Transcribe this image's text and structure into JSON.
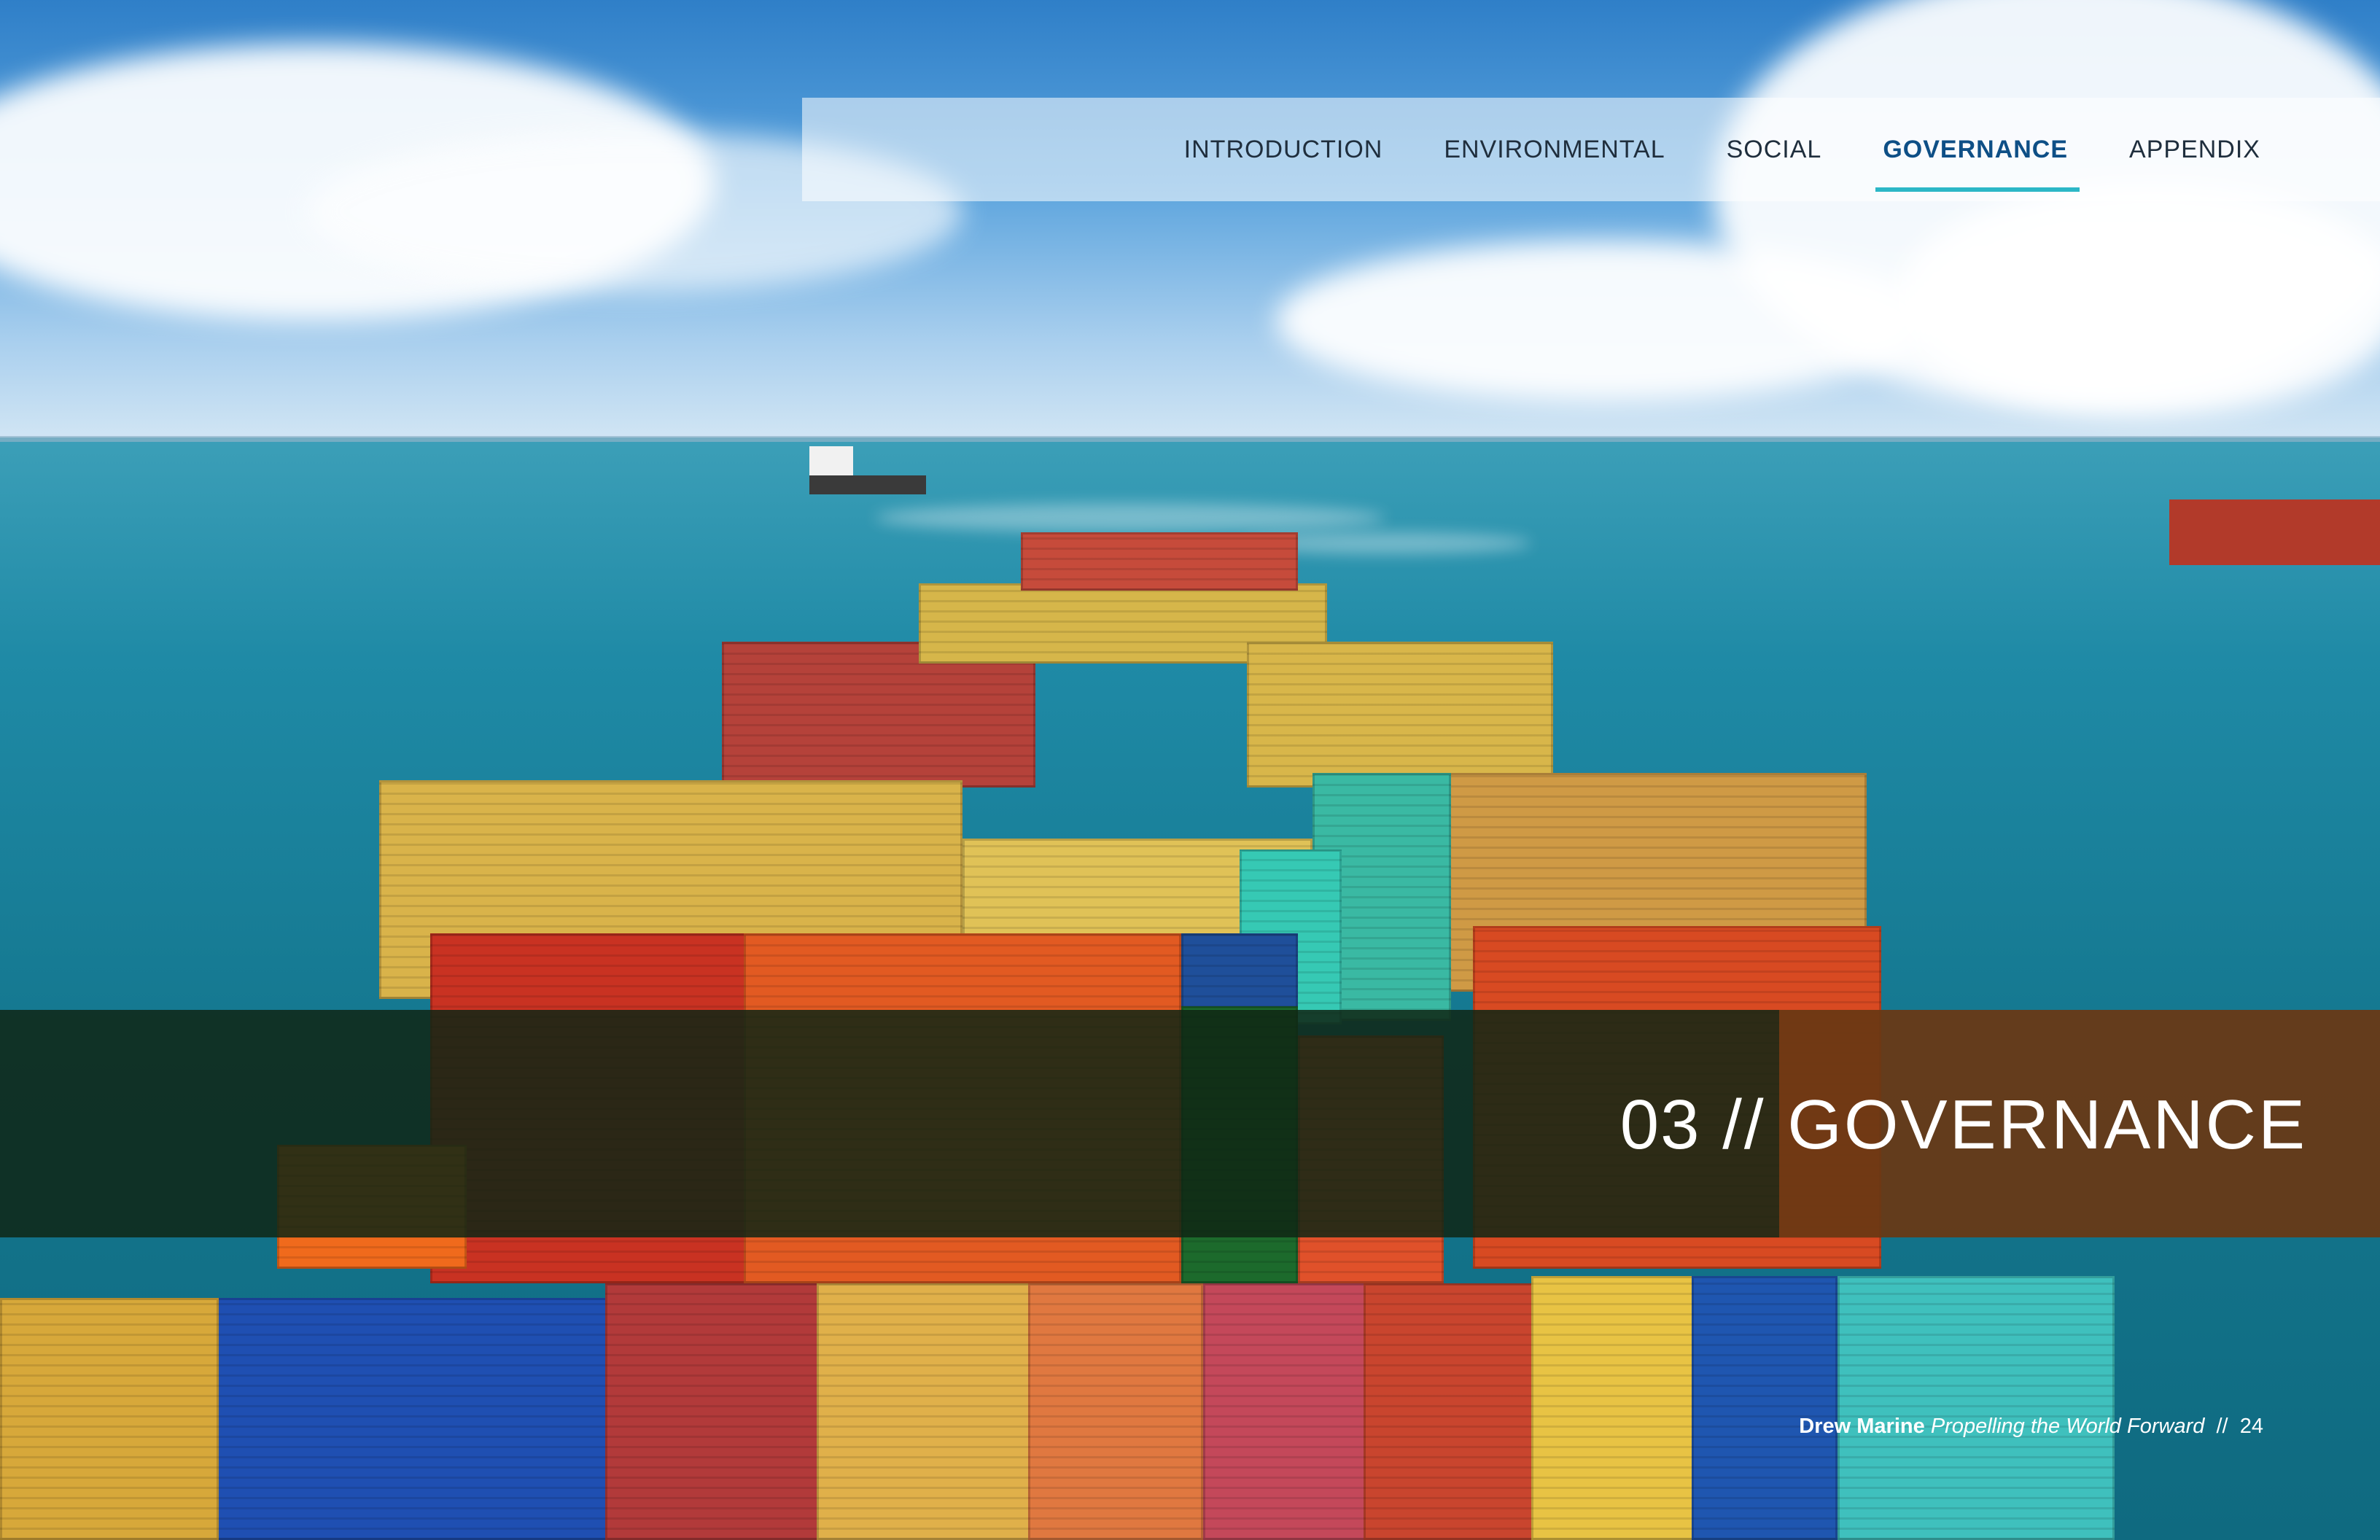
{
  "nav": {
    "items": [
      {
        "label": "Introduction",
        "active": false
      },
      {
        "label": "Environmental",
        "active": false
      },
      {
        "label": "Social",
        "active": false
      },
      {
        "label": "Governance",
        "active": true
      },
      {
        "label": "Appendix",
        "active": false
      }
    ]
  },
  "section": {
    "number": "03",
    "separator": "//",
    "title": "Governance"
  },
  "footer": {
    "brand": "Drew Marine",
    "tagline": "Propelling the World Forward",
    "separator": "//",
    "page_number": "24"
  },
  "colors": {
    "accent": "#2cb7c7",
    "active_nav": "#0e4f86",
    "band": "#0f2614"
  }
}
